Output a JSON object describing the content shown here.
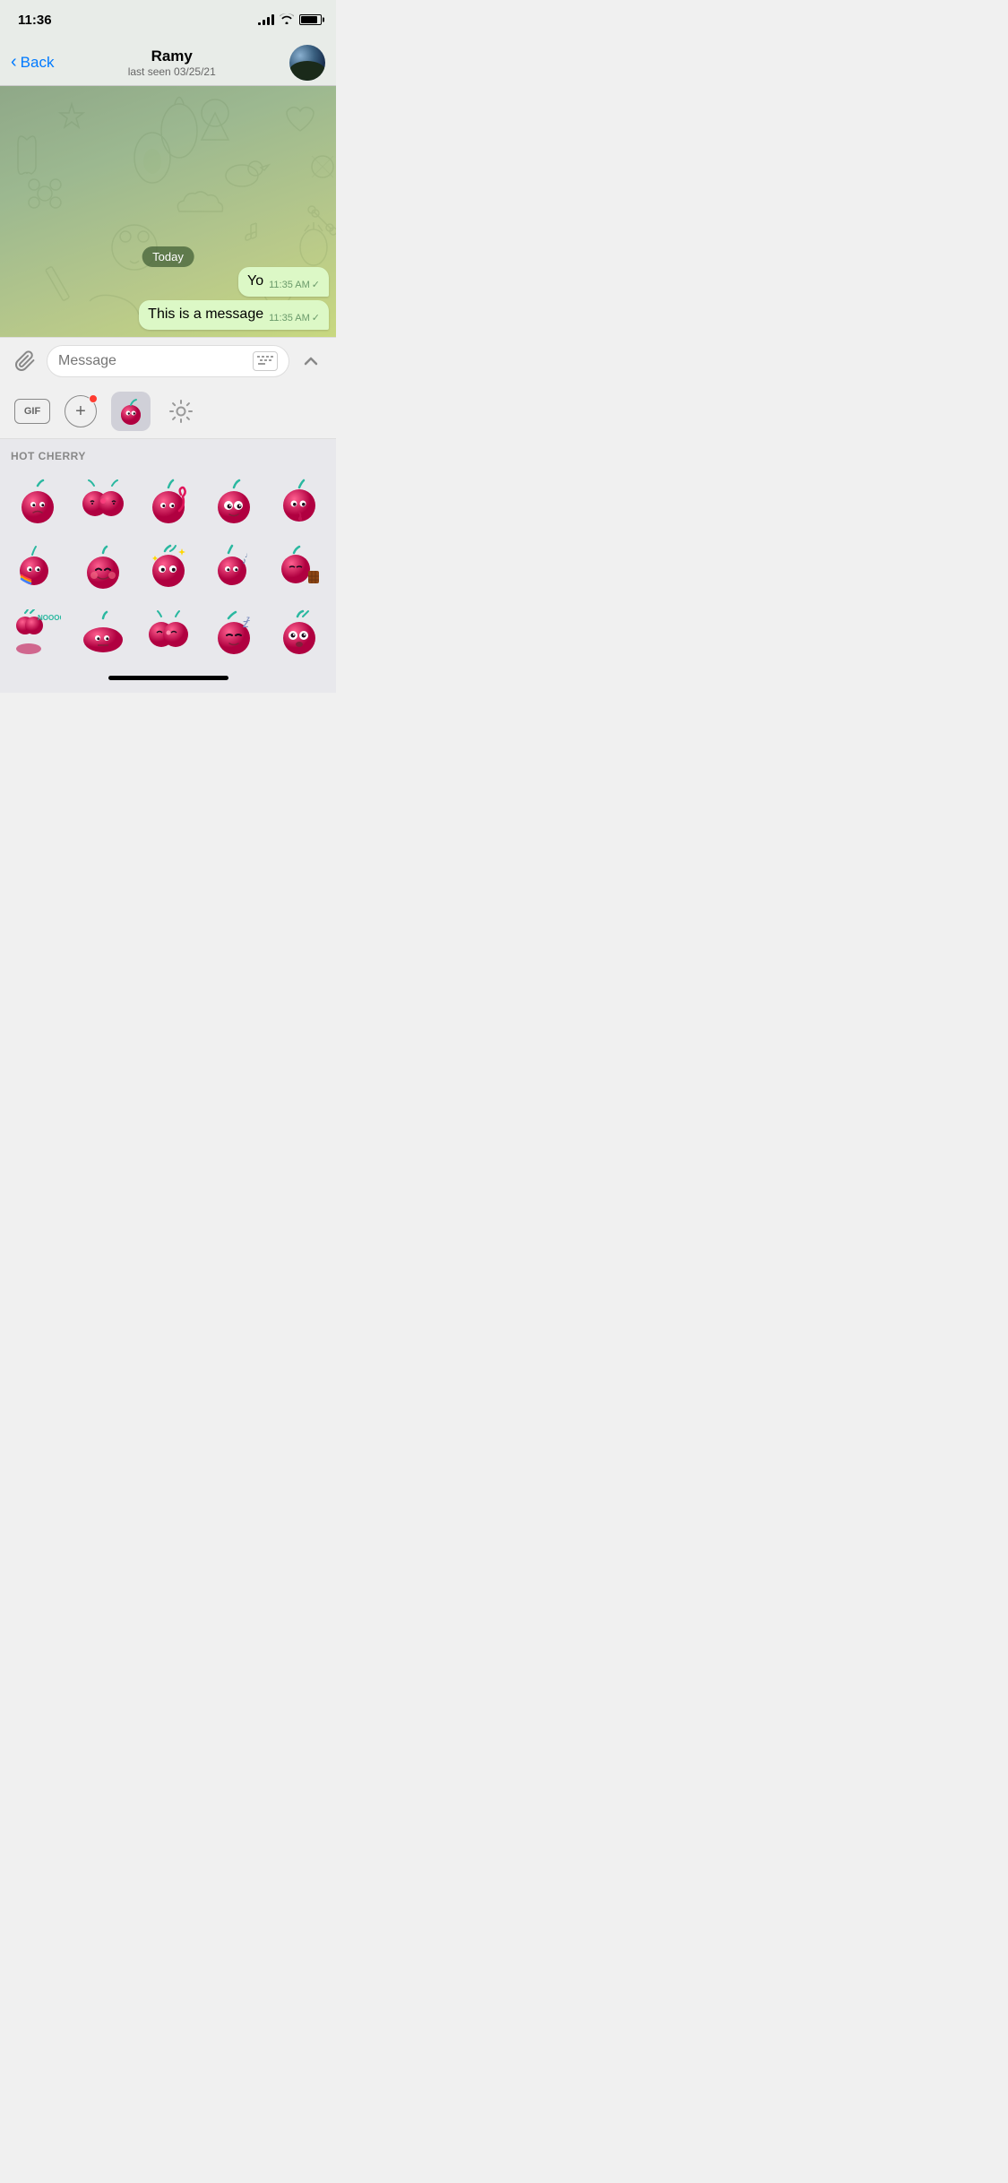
{
  "status": {
    "time": "11:36",
    "signal_bars": [
      3,
      6,
      9,
      12
    ],
    "wifi": "wifi",
    "battery_pct": 85
  },
  "nav": {
    "back_label": "Back",
    "contact_name": "Ramy",
    "last_seen": "last seen 03/25/21"
  },
  "chat": {
    "date_badge": "Today",
    "messages": [
      {
        "text": "Yo",
        "time": "11:35 AM",
        "check": "✓",
        "type": "outgoing"
      },
      {
        "text": "This is a message",
        "time": "11:35 AM",
        "check": "✓",
        "type": "outgoing"
      }
    ]
  },
  "input": {
    "placeholder": "Message"
  },
  "toolbar": {
    "gif_label": "GIF",
    "section_title": "HOT CHERRY"
  },
  "stickers": {
    "rows": [
      [
        "cherry-sad",
        "cherry-kiss",
        "cherry-wave",
        "cherry-wide-eyes",
        "cherry-drip"
      ],
      [
        "cherry-dance",
        "cherry-blush",
        "cherry-sparkle",
        "cherry-music",
        "cherry-chocolate"
      ],
      [
        "cherry-nooo",
        "cherry-flat",
        "cherry-kiss2",
        "cherry-sleepy",
        "cherry-shock"
      ]
    ]
  }
}
